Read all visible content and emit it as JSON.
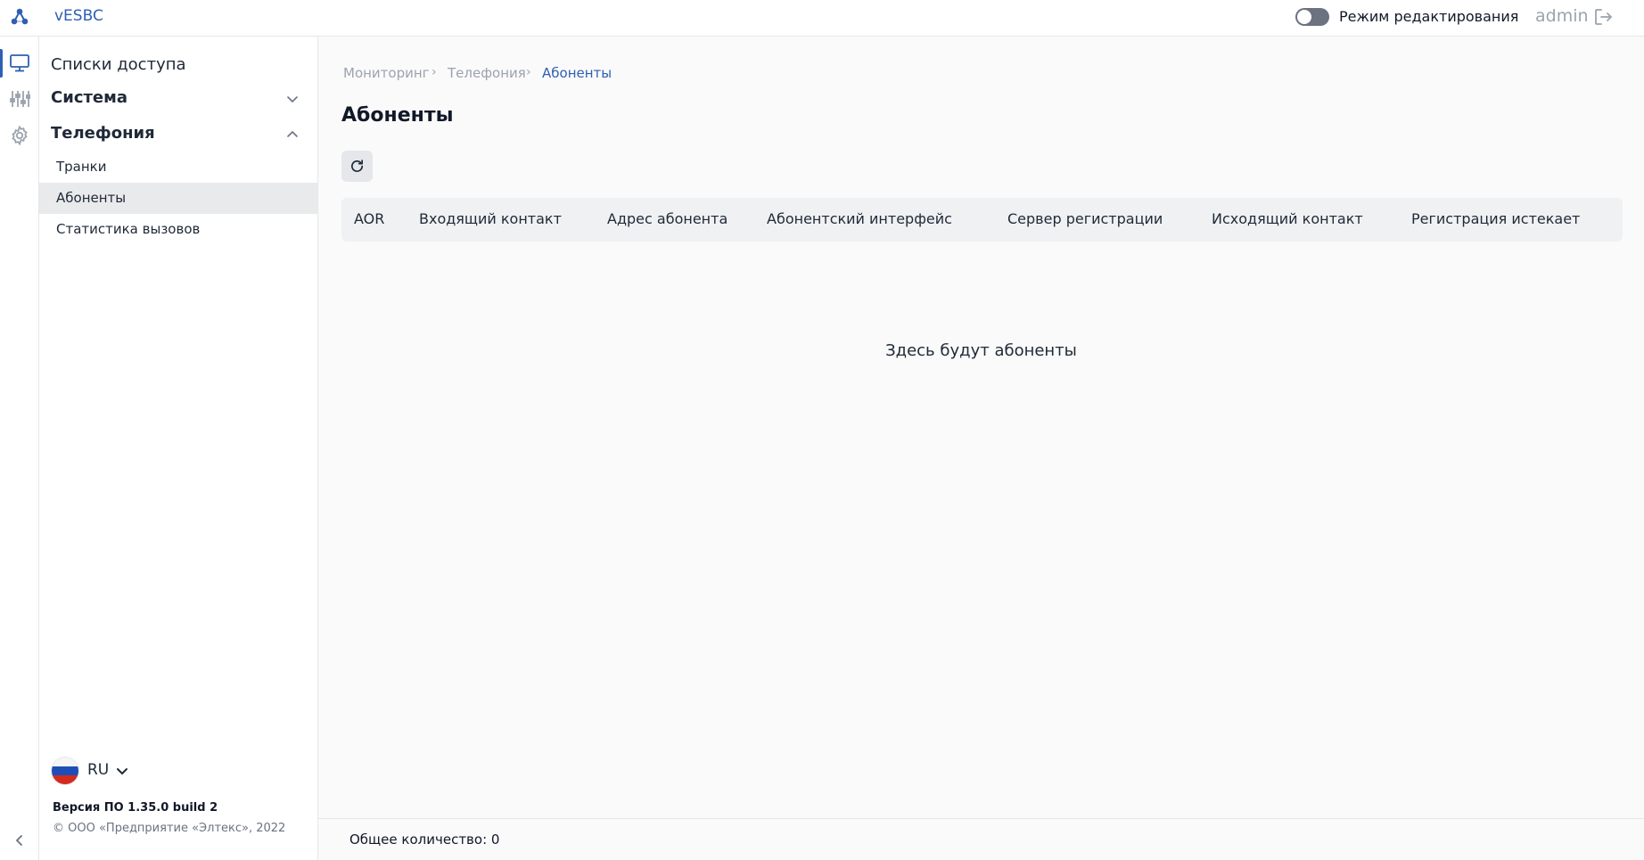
{
  "app": {
    "title": "vESBC"
  },
  "header": {
    "edit_mode_label": "Режим редактирования",
    "edit_mode_on": false,
    "user": "admin"
  },
  "rail": {
    "items": [
      {
        "icon": "monitor-icon",
        "active": true
      },
      {
        "icon": "sliders-icon",
        "active": false
      },
      {
        "icon": "gear-icon",
        "active": false
      }
    ]
  },
  "sidebar": {
    "access_lists": "Списки доступа",
    "system": "Система",
    "telephony": "Телефония",
    "telephony_items": [
      "Транки",
      "Абоненты",
      "Статистика вызовов"
    ],
    "active_item": "Абоненты",
    "language": "RU",
    "version": "Версия ПО 1.35.0 build 2",
    "copyright": "© ООО «Предприятие «Элтекс», 2022"
  },
  "main": {
    "breadcrumb": [
      "Мониторинг",
      "Телефония",
      "Абоненты"
    ],
    "title": "Абоненты",
    "columns": [
      "AOR",
      "Входящий контакт",
      "Адрес абонента",
      "Абонентский интерфейс",
      "Сервер регистрации",
      "Исходящий контакт",
      "Регистрация истекает"
    ],
    "empty_text": "Здесь будут абоненты",
    "total_label": "Общее количество:",
    "total_value": "0"
  },
  "colors": {
    "accent": "#2f5fb3",
    "toggle_off": "#6b7280",
    "active_row": "#e9eaec"
  }
}
